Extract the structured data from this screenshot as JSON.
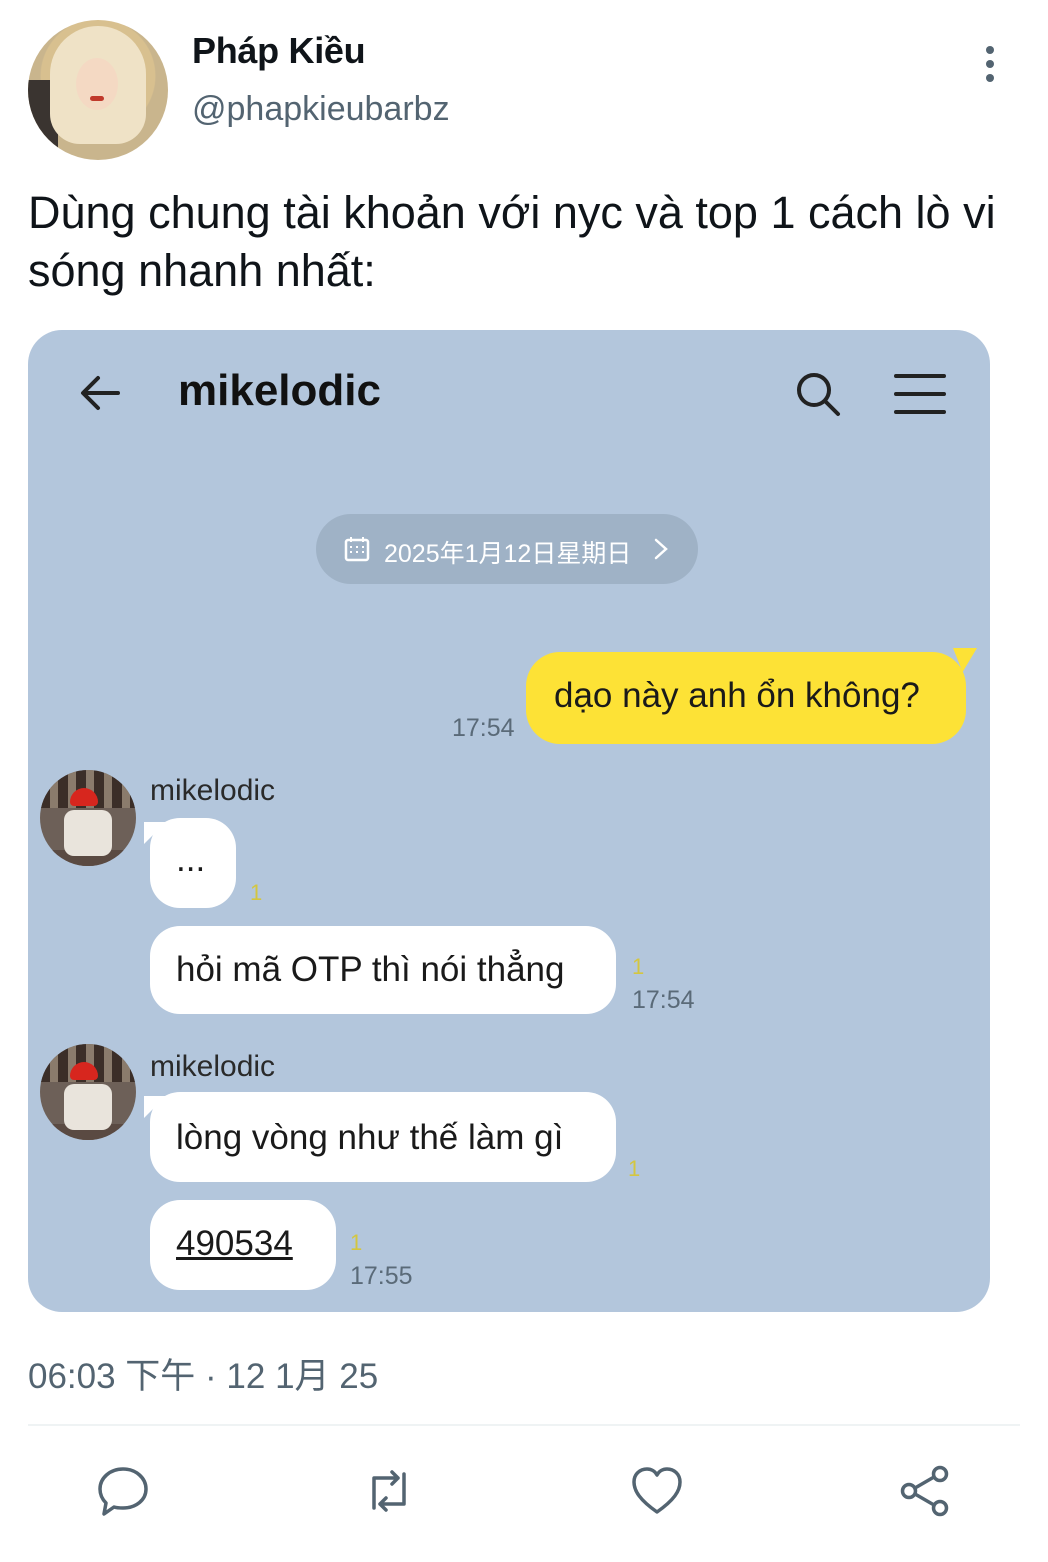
{
  "author": {
    "display_name": "Pháp Kiều",
    "handle": "@phapkieubarbz"
  },
  "tweet": {
    "text": "Dùng chung tài khoản với nyc và top 1 cách lò vi sóng nhanh nhất:",
    "timestamp": "06:03 下午 · 12 1月 25"
  },
  "chat": {
    "title": "mikelodic",
    "date_label": "2025年1月12日星期日",
    "messages": [
      {
        "from": "me",
        "text": "dạo này anh ổn không?",
        "time": "17:54"
      },
      {
        "from": "mikelodic",
        "sender": "mikelodic",
        "text": "...",
        "read": "1"
      },
      {
        "from": "mikelodic",
        "text": "hỏi mã OTP thì nói thẳng",
        "read": "1",
        "time": "17:54"
      },
      {
        "from": "mikelodic",
        "sender": "mikelodic",
        "text": "lòng vòng như thế làm gì",
        "read": "1"
      },
      {
        "from": "mikelodic",
        "text": "490534",
        "read": "1",
        "time": "17:55"
      }
    ]
  },
  "icons": {
    "more": "more-vertical-icon",
    "back": "arrow-left-icon",
    "search": "search-icon",
    "menu": "hamburger-menu-icon",
    "calendar": "calendar-icon",
    "reply": "reply-icon",
    "retweet": "retweet-icon",
    "like": "heart-icon",
    "share": "share-icon"
  },
  "colors": {
    "chat_bg": "#b3c6dc",
    "my_bubble": "#fde236",
    "link": "#2f78c4",
    "muted": "#536471"
  }
}
